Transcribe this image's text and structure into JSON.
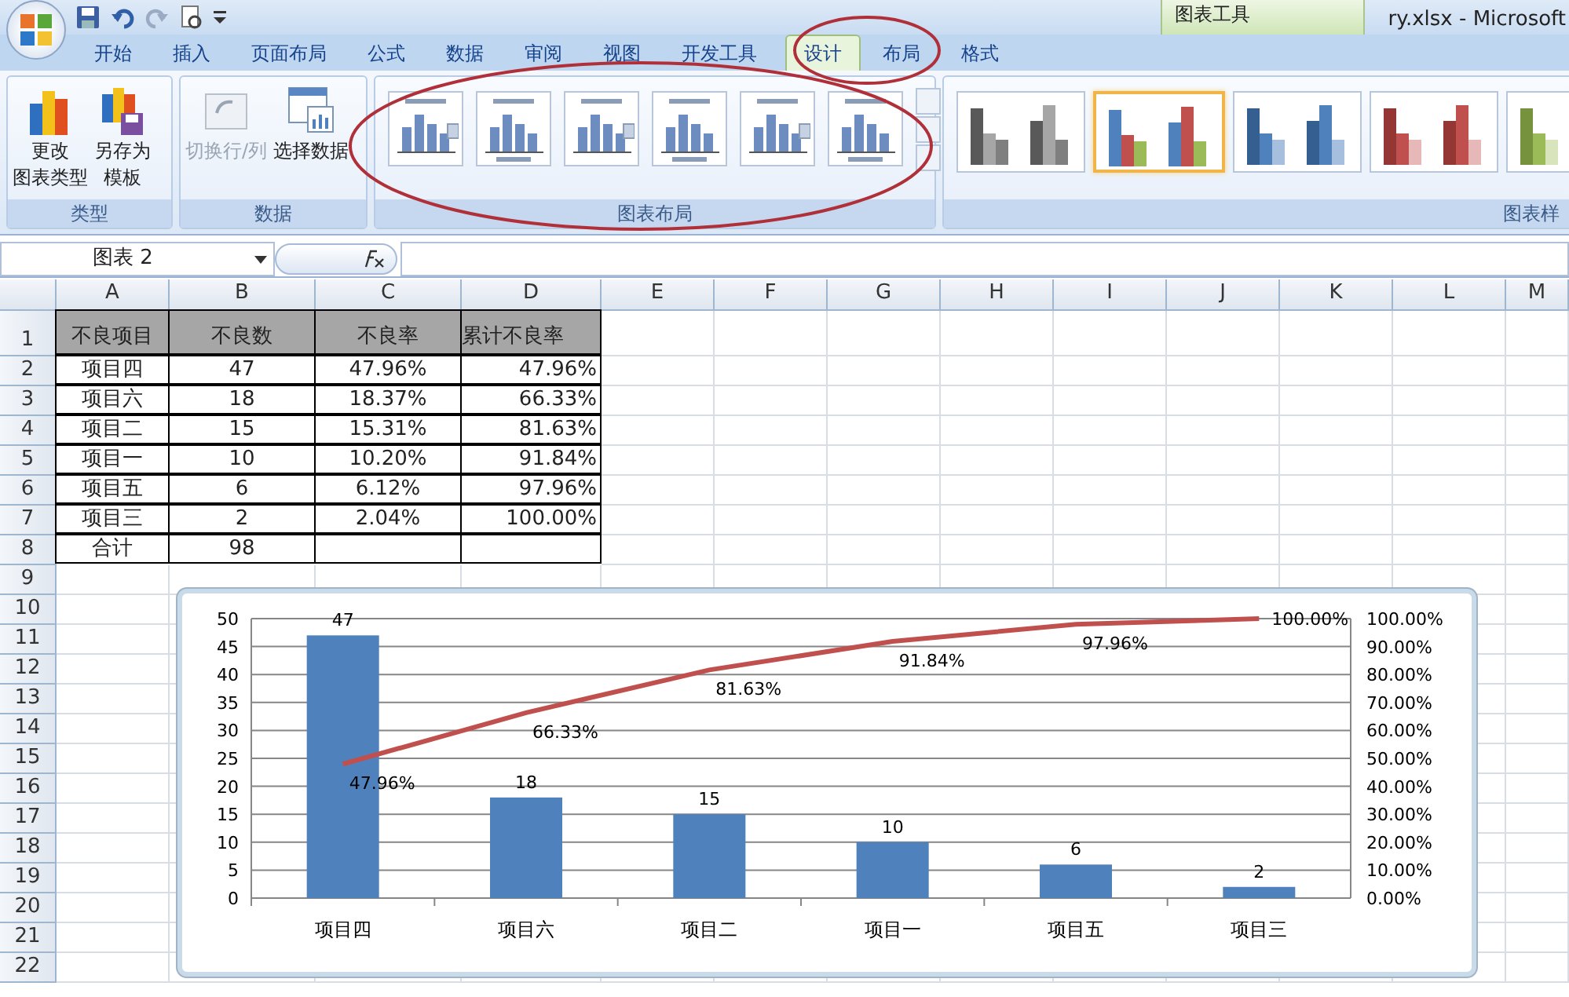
{
  "title_bar": {
    "contextual_label": "图表工具",
    "title": "ry.xlsx - Microsoft"
  },
  "tabs": [
    {
      "label": "开始",
      "selected": false
    },
    {
      "label": "插入",
      "selected": false
    },
    {
      "label": "页面布局",
      "selected": false
    },
    {
      "label": "公式",
      "selected": false
    },
    {
      "label": "数据",
      "selected": false
    },
    {
      "label": "审阅",
      "selected": false
    },
    {
      "label": "视图",
      "selected": false
    },
    {
      "label": "开发工具",
      "selected": false
    },
    {
      "label": "设计",
      "selected": true
    },
    {
      "label": "布局",
      "selected": false
    },
    {
      "label": "格式",
      "selected": false
    }
  ],
  "ribbon": {
    "groups": [
      {
        "kind": "buttons",
        "label": "类型",
        "buttons": [
          {
            "lines": [
              "更改",
              "图表类型"
            ],
            "disabled": false
          },
          {
            "lines": [
              "另存为",
              "模板"
            ],
            "disabled": false
          }
        ]
      },
      {
        "kind": "buttons",
        "label": "数据",
        "buttons": [
          {
            "lines": [
              "切换行/列"
            ],
            "disabled": true
          },
          {
            "lines": [
              "选择数据"
            ],
            "disabled": false
          }
        ]
      },
      {
        "kind": "layouts",
        "label": "图表布局"
      },
      {
        "kind": "styles",
        "label": "图表样",
        "styles": [
          {
            "selected": false
          },
          {
            "selected": true
          },
          {
            "selected": false
          },
          {
            "selected": false
          },
          {
            "selected": false
          }
        ]
      }
    ]
  },
  "formula_bar": {
    "name_box": "图表 2"
  },
  "sheet": {
    "columns": [
      "A",
      "B",
      "C",
      "D",
      "E",
      "F",
      "G",
      "H",
      "I",
      "J",
      "K",
      "L",
      "M"
    ],
    "rows": [
      "1",
      "2",
      "3",
      "4",
      "5",
      "6",
      "7",
      "8",
      "9",
      "10",
      "11",
      "12",
      "13",
      "14",
      "15",
      "16",
      "17",
      "18",
      "19",
      "20",
      "21",
      "22"
    ],
    "cells": [
      {
        "kind": "header",
        "values": [
          "不良项目",
          "不良数",
          "不良率",
          "累计不良率"
        ]
      },
      {
        "kind": "data",
        "values": [
          "项目四",
          "47",
          "47.96%",
          "47.96%"
        ]
      },
      {
        "kind": "data",
        "values": [
          "项目六",
          "18",
          "18.37%",
          "66.33%"
        ]
      },
      {
        "kind": "data",
        "values": [
          "项目二",
          "15",
          "15.31%",
          "81.63%"
        ]
      },
      {
        "kind": "data",
        "values": [
          "项目一",
          "10",
          "10.20%",
          "91.84%"
        ]
      },
      {
        "kind": "data",
        "values": [
          "项目五",
          "6",
          "6.12%",
          "97.96%"
        ]
      },
      {
        "kind": "data",
        "values": [
          "项目三",
          "2",
          "2.04%",
          "100.00%"
        ]
      },
      {
        "kind": "data",
        "values": [
          "合计",
          "98"
        ]
      }
    ]
  },
  "chart": {
    "bars": {
      "chart_data": {
        "type": "bar",
        "categories": [
          "项目四",
          "项目六",
          "项目二",
          "项目一",
          "项目五",
          "项目三"
        ],
        "ylim": [
          0,
          50
        ],
        "yticks": [
          0,
          5,
          10,
          15,
          20,
          25,
          30,
          35,
          40,
          45,
          50
        ],
        "grid": true,
        "series": [
          {
            "color": "#4f81bd",
            "values": [
              47,
              18,
              15,
              10,
              6,
              2
            ]
          }
        ],
        "value_labels": [
          "47",
          "18",
          "15",
          "10",
          "6",
          "2"
        ]
      }
    },
    "cumulative": {
      "chart_data": {
        "type": "line",
        "ylim": [
          0,
          100
        ],
        "yticks": [
          {
            "value": 0,
            "label": "0.00%"
          },
          {
            "value": 10,
            "label": "10.00%"
          },
          {
            "value": 20,
            "label": "20.00%"
          },
          {
            "value": 30,
            "label": "30.00%"
          },
          {
            "value": 40,
            "label": "40.00%"
          },
          {
            "value": 50,
            "label": "50.00%"
          },
          {
            "value": 60,
            "label": "60.00%"
          },
          {
            "value": 70,
            "label": "70.00%"
          },
          {
            "value": 80,
            "label": "80.00%"
          },
          {
            "value": 90,
            "label": "90.00%"
          },
          {
            "value": 100,
            "label": "100.00%"
          }
        ],
        "series": [
          {
            "color": "#c0504d",
            "values": [
              47.96,
              66.33,
              81.63,
              91.84,
              97.96,
              100
            ]
          }
        ],
        "value_labels": [
          "47.96%",
          "66.33%",
          "81.63%",
          "91.84%",
          "97.96%",
          "100.00%"
        ]
      }
    }
  }
}
